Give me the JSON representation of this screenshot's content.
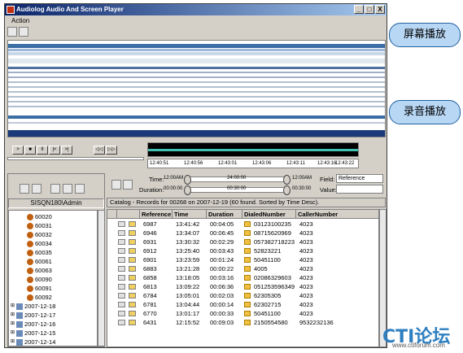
{
  "window": {
    "title": "Audiolog Audio And Screen Player",
    "menu": "Action",
    "btn_min": "_",
    "btn_max": "□",
    "btn_close": "X"
  },
  "callouts": {
    "screen": "屏幕播放",
    "audio": "录音播放"
  },
  "player": {
    "buttons": [
      ">",
      "■",
      "II",
      "|<",
      ">|",
      "◁◁",
      "▷▷"
    ],
    "times": [
      "12:40:51",
      "12:40:56",
      "12:43:01",
      "12:43:06",
      "12:43:11",
      "12:43:16",
      "12:43:22"
    ]
  },
  "left": {
    "user": "SISQN180\\Admin",
    "agents": [
      "60020",
      "60031",
      "60032",
      "60034",
      "60035",
      "60061",
      "60063",
      "60090",
      "60091",
      "60092"
    ],
    "dates": [
      "2007-12-18",
      "2007-12-17",
      "2007-12-16",
      "2007-12-15",
      "2007-12-14"
    ]
  },
  "filter": {
    "time_label": "Time:",
    "time_from": "12:00AM",
    "time_mid": "24:00:00",
    "time_to": "12:00AM",
    "duration_label": "Duration:",
    "dur_from": "00:00:00",
    "dur_mid": "00:30:00",
    "dur_to": "00:30:00",
    "field_label": "Field:",
    "field_value": "Reference",
    "value_label": "Value:"
  },
  "catalog": {
    "text": "Catalog - Records for 00268 on 2007-12-19 (60 found. Sorted by Time Desc)."
  },
  "grid": {
    "headers": [
      "Reference",
      "Time",
      "Duration",
      "DialedNumber",
      "CallerNumber"
    ],
    "rows": [
      [
        "6987",
        "13:41:42",
        "00:04:05",
        "03123100235",
        "4023"
      ],
      [
        "6946",
        "13:34:07",
        "00:06:45",
        "08715620969",
        "4023"
      ],
      [
        "6931",
        "13:30:32",
        "00:02:29",
        "057382718223",
        "4023"
      ],
      [
        "6912",
        "13:25:40",
        "00:03:43",
        "52823221",
        "4023"
      ],
      [
        "6901",
        "13:23:59",
        "00:01:24",
        "50451100",
        "4023"
      ],
      [
        "6883",
        "13:21:28",
        "00:00:22",
        "4005",
        "4023"
      ],
      [
        "6858",
        "13:18:05",
        "00:03:16",
        "02086329603",
        "4023"
      ],
      [
        "6813",
        "13:09:22",
        "00:06:36",
        "051253596349",
        "4023"
      ],
      [
        "6784",
        "13:05:01",
        "00:02:03",
        "62305305",
        "4023"
      ],
      [
        "6781",
        "13:04:44",
        "00:00:14",
        "62302715",
        "4023"
      ],
      [
        "6770",
        "13:01:17",
        "00:00:33",
        "50451100",
        "4023"
      ],
      [
        "6431",
        "12:15:52",
        "00:09:03",
        "2150554580",
        "9532232136"
      ]
    ]
  },
  "logo": {
    "main": "CTI论坛",
    "sub": "www.ctiforum.com"
  }
}
